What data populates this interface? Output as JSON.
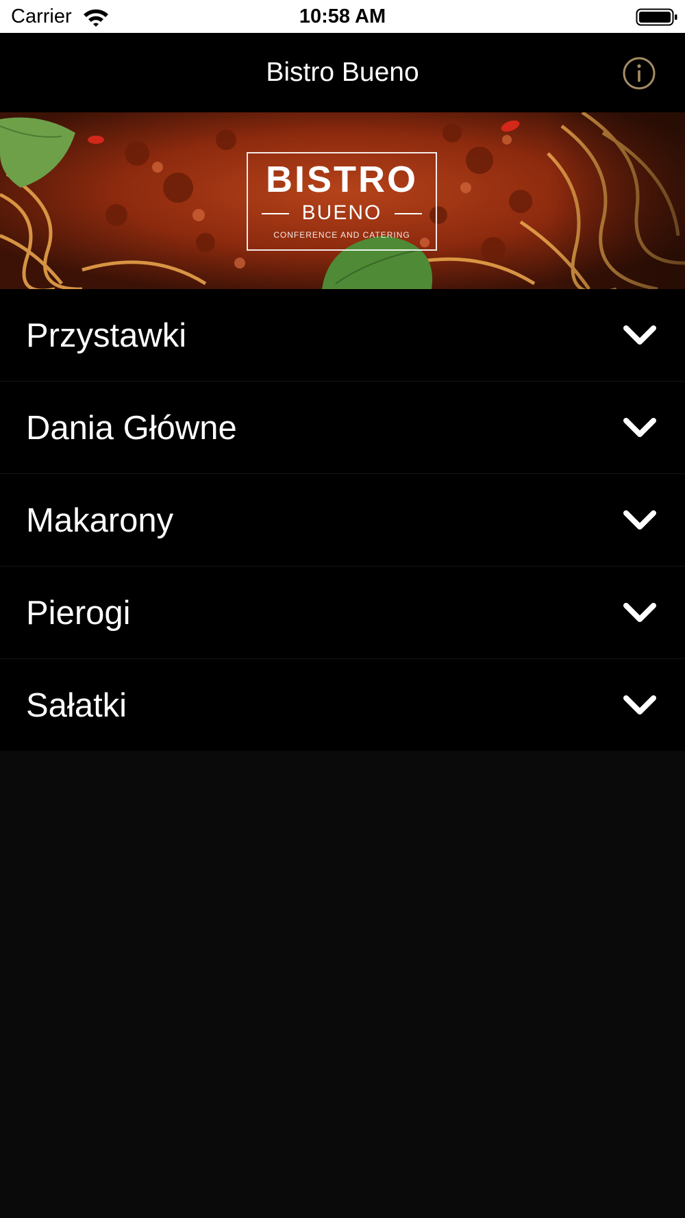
{
  "status_bar": {
    "carrier": "Carrier",
    "time": "10:58 AM",
    "wifi_icon": "wifi-icon",
    "battery_icon": "battery-icon"
  },
  "nav": {
    "title": "Bistro Bueno",
    "info_icon": "info-circle-icon",
    "accent_color": "#a58c64"
  },
  "hero": {
    "logo_line1": "BISTRO",
    "logo_line2": "BUENO",
    "logo_line3": "CONFERENCE AND CATERING"
  },
  "menu": {
    "chevron_icon": "chevron-down-icon",
    "items": [
      {
        "label": "Przystawki"
      },
      {
        "label": "Dania Główne"
      },
      {
        "label": "Makarony"
      },
      {
        "label": "Pierogi"
      },
      {
        "label": "Sałatki"
      }
    ]
  }
}
